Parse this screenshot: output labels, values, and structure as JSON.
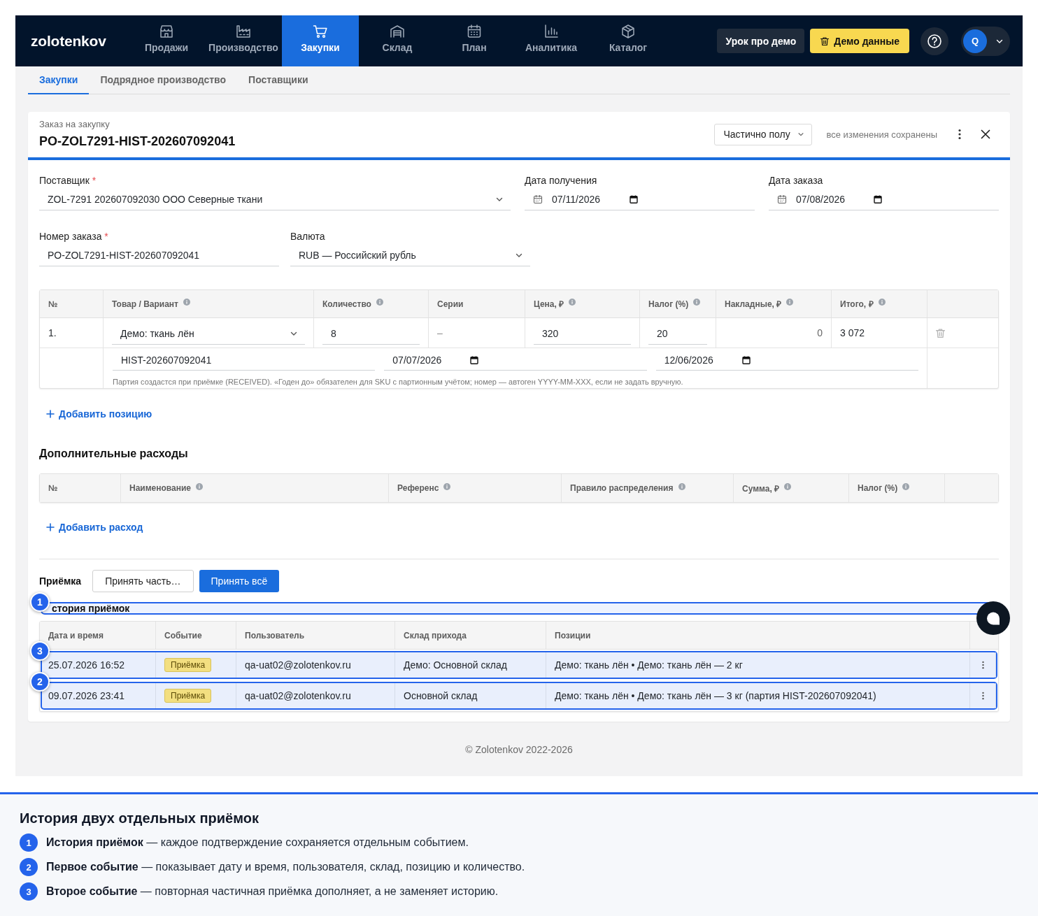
{
  "top_nav": {
    "logo": "zolotenkov",
    "items": [
      {
        "label": "Продажи",
        "selected": false
      },
      {
        "label": "Производство",
        "selected": false
      },
      {
        "label": "Закупки",
        "selected": true
      },
      {
        "label": "Склад",
        "selected": false
      },
      {
        "label": "План",
        "selected": false
      },
      {
        "label": "Аналитика",
        "selected": false
      },
      {
        "label": "Каталог",
        "selected": false
      }
    ],
    "buttons": [
      {
        "label": "Урок про демо",
        "kind": "dark"
      },
      {
        "label": "Демо данные",
        "kind": "demo"
      }
    ],
    "avatar": "Q"
  },
  "sub_tabs": [
    {
      "label": "Закупки",
      "selected": true
    },
    {
      "label": "Подрядное производство",
      "selected": false
    },
    {
      "label": "Поставщики",
      "selected": false
    }
  ],
  "order": {
    "kicker": "Заказ на закупку",
    "title": "PO-ZOL7291-HIST-202607092041",
    "status": "Частично полу",
    "save_state": "все изменения сохранены",
    "field_rows": [
      [
        {
          "label": "Поставщик",
          "required_mark": "*",
          "kind": "select",
          "value": "ZOL-7291 202607092030 ООО Северные ткани"
        },
        {
          "label": "Дата получения",
          "kind": "date",
          "value": "07/11/2026"
        },
        {
          "label": "Дата заказа",
          "kind": "date",
          "value": "07/08/2026"
        }
      ],
      [
        {
          "label": "Номер заказа",
          "required_mark": "*",
          "kind": "text",
          "value": "PO-ZOL7291-HIST-202607092041"
        },
        {
          "label": "Валюта",
          "kind": "select",
          "value": "RUB — Российский рубль"
        }
      ]
    ],
    "items": {
      "columns": [
        {
          "label": "№",
          "info": false
        },
        {
          "label": "Товар / Вариант",
          "info": true
        },
        {
          "label": "Количество",
          "info": true
        },
        {
          "label": "Серии",
          "info": false
        },
        {
          "label": "Цена, ₽",
          "info": true
        },
        {
          "label": "Налог (%)",
          "info": true
        },
        {
          "label": "Накладные, ₽",
          "info": true
        },
        {
          "label": "Итого, ₽",
          "info": true
        }
      ],
      "rows": [
        {
          "number": "1.",
          "product": "Демо: ткань лён",
          "quantity": "8",
          "series": "–",
          "price": "320",
          "tax": "20",
          "overhead": "0",
          "total": "3 072",
          "batch": {
            "number": "HIST-202607092041",
            "dates": [
              "07/07/2026",
              "12/06/2026"
            ],
            "note": "Партия создастся при приёмке (RECEIVED). «Годен до» обязателен для SKU с партионным учётом; номер — автоген YYYY-MM-XXX, если не задать вручную."
          }
        }
      ],
      "add_link": "Добавить позицию"
    },
    "expenses": {
      "title": "Дополнительные расходы",
      "columns": [
        {
          "label": "№",
          "info": false
        },
        {
          "label": "Наименование",
          "info": true
        },
        {
          "label": "Референс",
          "info": true
        },
        {
          "label": "Правило распределения",
          "info": true
        },
        {
          "label": "Сумма, ₽",
          "info": true
        },
        {
          "label": "Налог (%)",
          "info": true
        }
      ],
      "add_link": "Добавить расход"
    },
    "receipt": {
      "label": "Приёмка",
      "buttons": [
        {
          "label": "Принять часть…",
          "kind": "secondary"
        },
        {
          "label": "Принять всё",
          "kind": "primary"
        }
      ]
    },
    "history": {
      "title": "стория приёмок",
      "callout": "1",
      "columns": [
        {
          "label": "Дата и время"
        },
        {
          "label": "Событие"
        },
        {
          "label": "Пользователь"
        },
        {
          "label": "Склад прихода"
        },
        {
          "label": "Позиции"
        }
      ],
      "rows": [
        {
          "datetime": "25.07.2026 16:52",
          "event": "Приёмка",
          "user": "qa-uat02@zolotenkov.ru",
          "warehouse": "Демо: Основной склад",
          "positions": "Демо: ткань лён • Демо: ткань лён — 2 кг",
          "callout": "3"
        },
        {
          "datetime": "09.07.2026 23:41",
          "event": "Приёмка",
          "user": "qa-uat02@zolotenkov.ru",
          "warehouse": "Основной склад",
          "positions": "Демо: ткань лён • Демо: ткань лён — 3 кг (партия HIST-202607092041)",
          "callout": "2"
        }
      ]
    }
  },
  "footer": "© Zolotenkov 2022-2026",
  "legend": {
    "title": "История двух отдельных приёмок",
    "items": [
      {
        "number": "1",
        "text": "**История приёмок** — каждое подтверждение сохраняется отдельным событием."
      },
      {
        "number": "2",
        "text": "**Первое событие** — показывает дату и время, пользователя, склад, позицию и количество."
      },
      {
        "number": "3",
        "text": "**Второе событие** — повторная частичная приёмка дополняет, а не заменяет историю."
      }
    ]
  }
}
